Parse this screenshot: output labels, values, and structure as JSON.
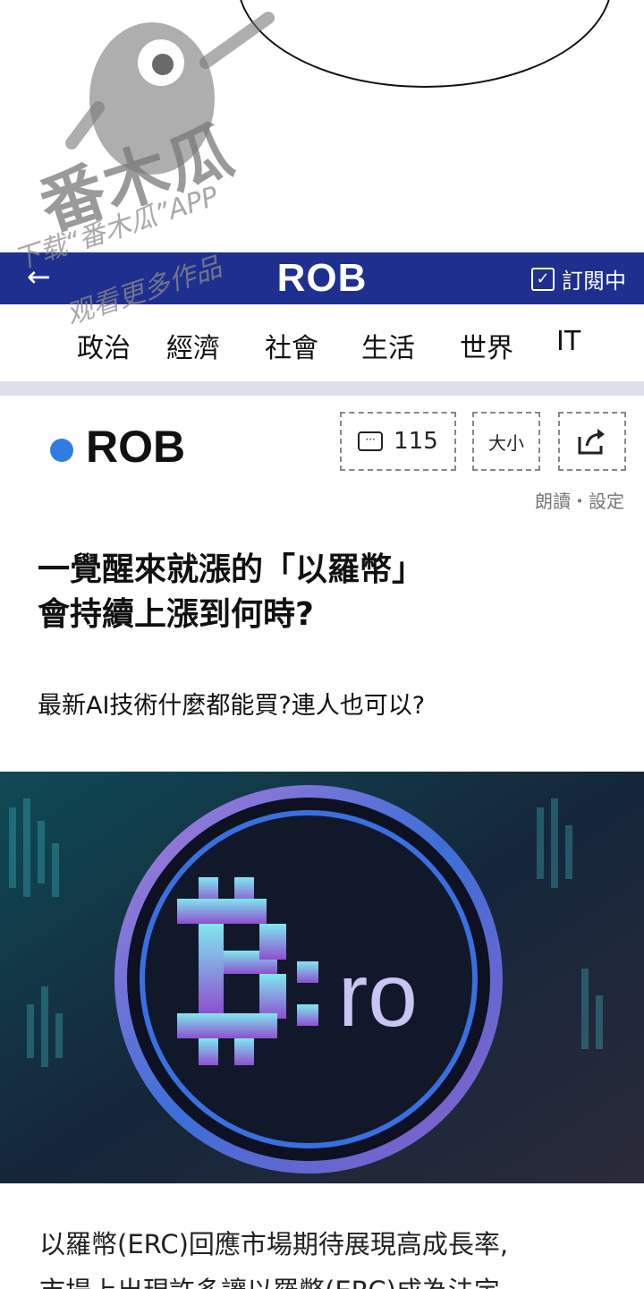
{
  "watermark": {
    "logo_text": "番木瓜",
    "line1": "下载“番木瓜”APP",
    "line2": "观看更多作品"
  },
  "header": {
    "back_icon": "back-arrow-icon",
    "title": "ROB",
    "subscribe_label": "訂閱中",
    "background": "#1f2f8f"
  },
  "categories": [
    "政治",
    "經濟",
    "社會",
    "生活",
    "世界",
    "IT"
  ],
  "article": {
    "source": "ROB",
    "source_dot_color": "#2f7de0",
    "comment_count": "115",
    "font_size_label": "大小",
    "share_icon": "share-icon",
    "read_settings": "朗讀・設定",
    "headline_line1": "一覺醒來就漲的「以羅幣」",
    "headline_line2": "會持續上漲到何時?",
    "subheadline": "最新AI技術什麼都能買?連人也可以?",
    "hero_logo_text": "ro",
    "body_line1": "以羅幣(ERC)回應市場期待展現高成長率,",
    "body_line2": "市場上出現許多讓以羅幣(ERC)成為法定"
  }
}
